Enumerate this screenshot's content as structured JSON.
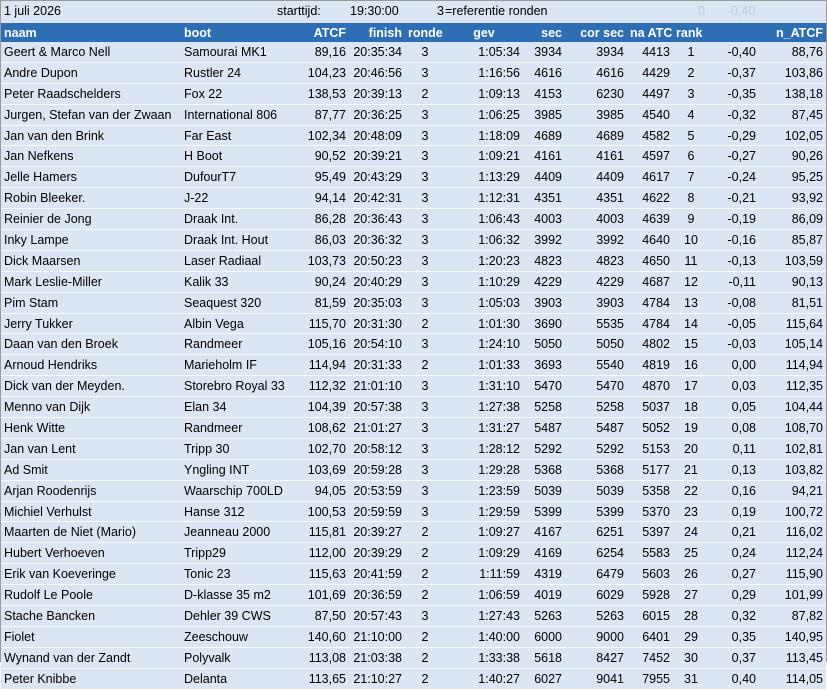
{
  "header": {
    "date": "1 juli 2026",
    "start_label": "starttijd:",
    "start_time": "19:30:00",
    "ref_rounds": "3",
    "ref_label": "=referentie ronden",
    "zero": "0",
    "ref_value": "0,40"
  },
  "columns": [
    "naam",
    "boot",
    "ATCF",
    "finish",
    "ronde",
    "gev",
    "sec",
    "cor sec",
    "na ATCF",
    "rank",
    "",
    "n_ATCF"
  ],
  "rows": [
    [
      "Geert & Marco Nell",
      "Samourai MK1",
      "89,16",
      "20:35:34",
      "3",
      "1:05:34",
      "3934",
      "3934",
      "4413",
      "1",
      "-0,40",
      "88,76"
    ],
    [
      "Andre Dupon",
      "Rustler 24",
      "104,23",
      "20:46:56",
      "3",
      "1:16:56",
      "4616",
      "4616",
      "4429",
      "2",
      "-0,37",
      "103,86"
    ],
    [
      "Peter Raadschelders",
      "Fox 22",
      "138,53",
      "20:39:13",
      "2",
      "1:09:13",
      "4153",
      "6230",
      "4497",
      "3",
      "-0,35",
      "138,18"
    ],
    [
      "Jurgen, Stefan van der Zwaan",
      "International 806",
      "87,77",
      "20:36:25",
      "3",
      "1:06:25",
      "3985",
      "3985",
      "4540",
      "4",
      "-0,32",
      "87,45"
    ],
    [
      "Jan van den Brink",
      "Far East",
      "102,34",
      "20:48:09",
      "3",
      "1:18:09",
      "4689",
      "4689",
      "4582",
      "5",
      "-0,29",
      "102,05"
    ],
    [
      "Jan Nefkens",
      "H Boot",
      "90,52",
      "20:39:21",
      "3",
      "1:09:21",
      "4161",
      "4161",
      "4597",
      "6",
      "-0,27",
      "90,26"
    ],
    [
      "Jelle Hamers",
      "DufourT7",
      "95,49",
      "20:43:29",
      "3",
      "1:13:29",
      "4409",
      "4409",
      "4617",
      "7",
      "-0,24",
      "95,25"
    ],
    [
      "Robin Bleeker.",
      "J-22",
      "94,14",
      "20:42:31",
      "3",
      "1:12:31",
      "4351",
      "4351",
      "4622",
      "8",
      "-0,21",
      "93,92"
    ],
    [
      "Reinier de Jong",
      "Draak Int.",
      "86,28",
      "20:36:43",
      "3",
      "1:06:43",
      "4003",
      "4003",
      "4639",
      "9",
      "-0,19",
      "86,09"
    ],
    [
      "Inky Lampe",
      "Draak Int. Hout",
      "86,03",
      "20:36:32",
      "3",
      "1:06:32",
      "3992",
      "3992",
      "4640",
      "10",
      "-0,16",
      "85,87"
    ],
    [
      "Dick Maarsen",
      "Laser Radiaal",
      "103,73",
      "20:50:23",
      "3",
      "1:20:23",
      "4823",
      "4823",
      "4650",
      "11",
      "-0,13",
      "103,59"
    ],
    [
      "Mark Leslie-Miller",
      "Kalik 33",
      "90,24",
      "20:40:29",
      "3",
      "1:10:29",
      "4229",
      "4229",
      "4687",
      "12",
      "-0,11",
      "90,13"
    ],
    [
      "Pim Stam",
      "Seaquest 320",
      "81,59",
      "20:35:03",
      "3",
      "1:05:03",
      "3903",
      "3903",
      "4784",
      "13",
      "-0,08",
      "81,51"
    ],
    [
      "Jerry Tukker",
      "Albin Vega",
      "115,70",
      "20:31:30",
      "2",
      "1:01:30",
      "3690",
      "5535",
      "4784",
      "14",
      "-0,05",
      "115,64"
    ],
    [
      "Daan van den Broek",
      "Randmeer",
      "105,16",
      "20:54:10",
      "3",
      "1:24:10",
      "5050",
      "5050",
      "4802",
      "15",
      "-0,03",
      "105,14"
    ],
    [
      "Arnoud Hendriks",
      "Marieholm IF",
      "114,94",
      "20:31:33",
      "2",
      "1:01:33",
      "3693",
      "5540",
      "4819",
      "16",
      "0,00",
      "114,94"
    ],
    [
      "Dick van der Meyden.",
      "Storebro Royal 33",
      "112,32",
      "21:01:10",
      "3",
      "1:31:10",
      "5470",
      "5470",
      "4870",
      "17",
      "0,03",
      "112,35"
    ],
    [
      "Menno van Dijk",
      "Elan 34",
      "104,39",
      "20:57:38",
      "3",
      "1:27:38",
      "5258",
      "5258",
      "5037",
      "18",
      "0,05",
      "104,44"
    ],
    [
      "Henk Witte",
      "Randmeer",
      "108,62",
      "21:01:27",
      "3",
      "1:31:27",
      "5487",
      "5487",
      "5052",
      "19",
      "0,08",
      "108,70"
    ],
    [
      "Jan van Lent",
      "Tripp 30",
      "102,70",
      "20:58:12",
      "3",
      "1:28:12",
      "5292",
      "5292",
      "5153",
      "20",
      "0,11",
      "102,81"
    ],
    [
      "Ad Smit",
      "Yngling INT",
      "103,69",
      "20:59:28",
      "3",
      "1:29:28",
      "5368",
      "5368",
      "5177",
      "21",
      "0,13",
      "103,82"
    ],
    [
      "Arjan Roodenrijs",
      "Waarschip 700LD",
      "94,05",
      "20:53:59",
      "3",
      "1:23:59",
      "5039",
      "5039",
      "5358",
      "22",
      "0,16",
      "94,21"
    ],
    [
      "Michiel Verhulst",
      "Hanse 312",
      "100,53",
      "20:59:59",
      "3",
      "1:29:59",
      "5399",
      "5399",
      "5370",
      "23",
      "0,19",
      "100,72"
    ],
    [
      "Maarten de Niet (Mario)",
      "Jeanneau 2000",
      "115,81",
      "20:39:27",
      "2",
      "1:09:27",
      "4167",
      "6251",
      "5397",
      "24",
      "0,21",
      "116,02"
    ],
    [
      "Hubert Verhoeven",
      "Tripp29",
      "112,00",
      "20:39:29",
      "2",
      "1:09:29",
      "4169",
      "6254",
      "5583",
      "25",
      "0,24",
      "112,24"
    ],
    [
      "Erik van Koeveringe",
      "Tonic 23",
      "115,63",
      "20:41:59",
      "2",
      "1:11:59",
      "4319",
      "6479",
      "5603",
      "26",
      "0,27",
      "115,90"
    ],
    [
      "Rudolf Le Poole",
      "D-klasse 35 m2",
      "101,69",
      "20:36:59",
      "2",
      "1:06:59",
      "4019",
      "6029",
      "5928",
      "27",
      "0,29",
      "101,99"
    ],
    [
      "Stache Bancken",
      "Dehler 39 CWS",
      "87,50",
      "20:57:43",
      "3",
      "1:27:43",
      "5263",
      "5263",
      "6015",
      "28",
      "0,32",
      "87,82"
    ],
    [
      "Fiolet",
      "Zeeschouw",
      "140,60",
      "21:10:00",
      "2",
      "1:40:00",
      "6000",
      "9000",
      "6401",
      "29",
      "0,35",
      "140,95"
    ],
    [
      "Wynand van der Zandt",
      "Polyvalk",
      "113,08",
      "21:03:38",
      "2",
      "1:33:38",
      "5618",
      "8427",
      "7452",
      "30",
      "0,37",
      "113,45"
    ],
    [
      "Peter Knibbe",
      "Delanta",
      "113,65",
      "21:10:27",
      "2",
      "1:40:27",
      "6027",
      "9041",
      "7955",
      "31",
      "0,40",
      "114,05"
    ]
  ]
}
